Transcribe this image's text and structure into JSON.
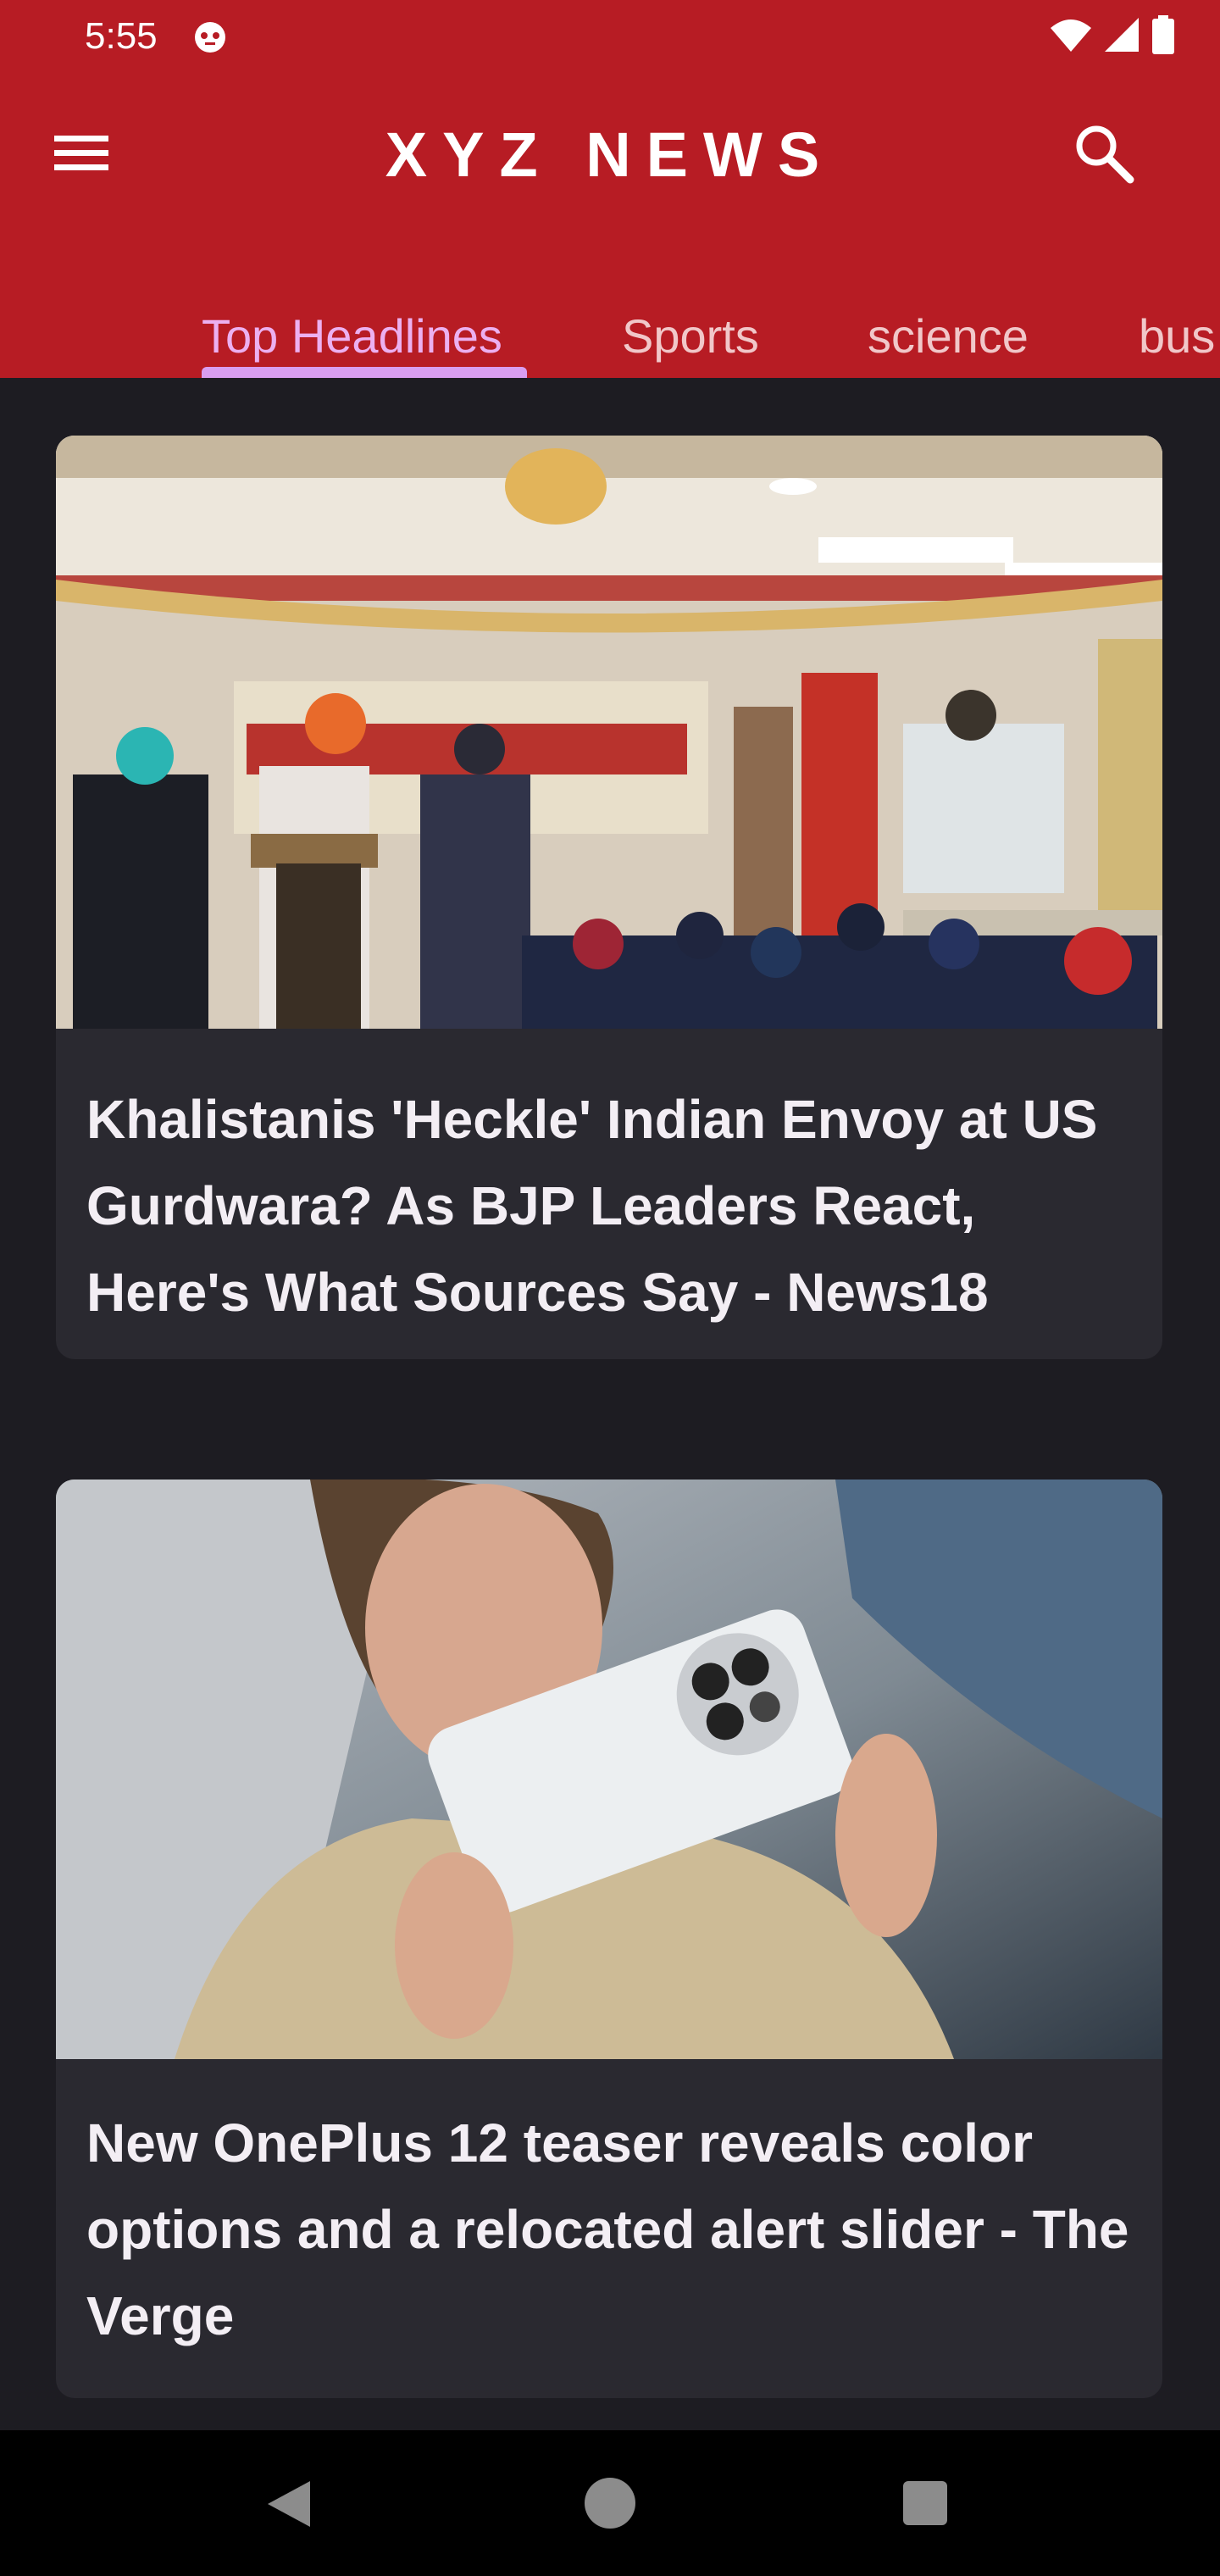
{
  "status_bar": {
    "time": "5:55"
  },
  "app_bar": {
    "title": "XYZ NEWS",
    "menu_icon": "hamburger-menu-icon",
    "search_icon": "search-icon"
  },
  "tabs": [
    {
      "label": "Top Headlines",
      "selected": true
    },
    {
      "label": "Sports",
      "selected": false
    },
    {
      "label": "science",
      "selected": false
    },
    {
      "label": "bus",
      "selected": false
    }
  ],
  "articles": [
    {
      "title": "Khalistanis 'Heckle' Indian Envoy at US Gurdwara? As BJP Leaders React, Here's What Sources Say - News18",
      "image_desc": "speaker-at-gurdwara-podium"
    },
    {
      "title": "New OnePlus 12 teaser reveals color options and a relocated alert slider - The Verge",
      "image_desc": "woman-holding-white-phone"
    }
  ],
  "colors": {
    "app_bar": "#b71c24",
    "background": "#1d1c22",
    "card": "#2a2930",
    "tab_indicator": "#d99ef0"
  }
}
